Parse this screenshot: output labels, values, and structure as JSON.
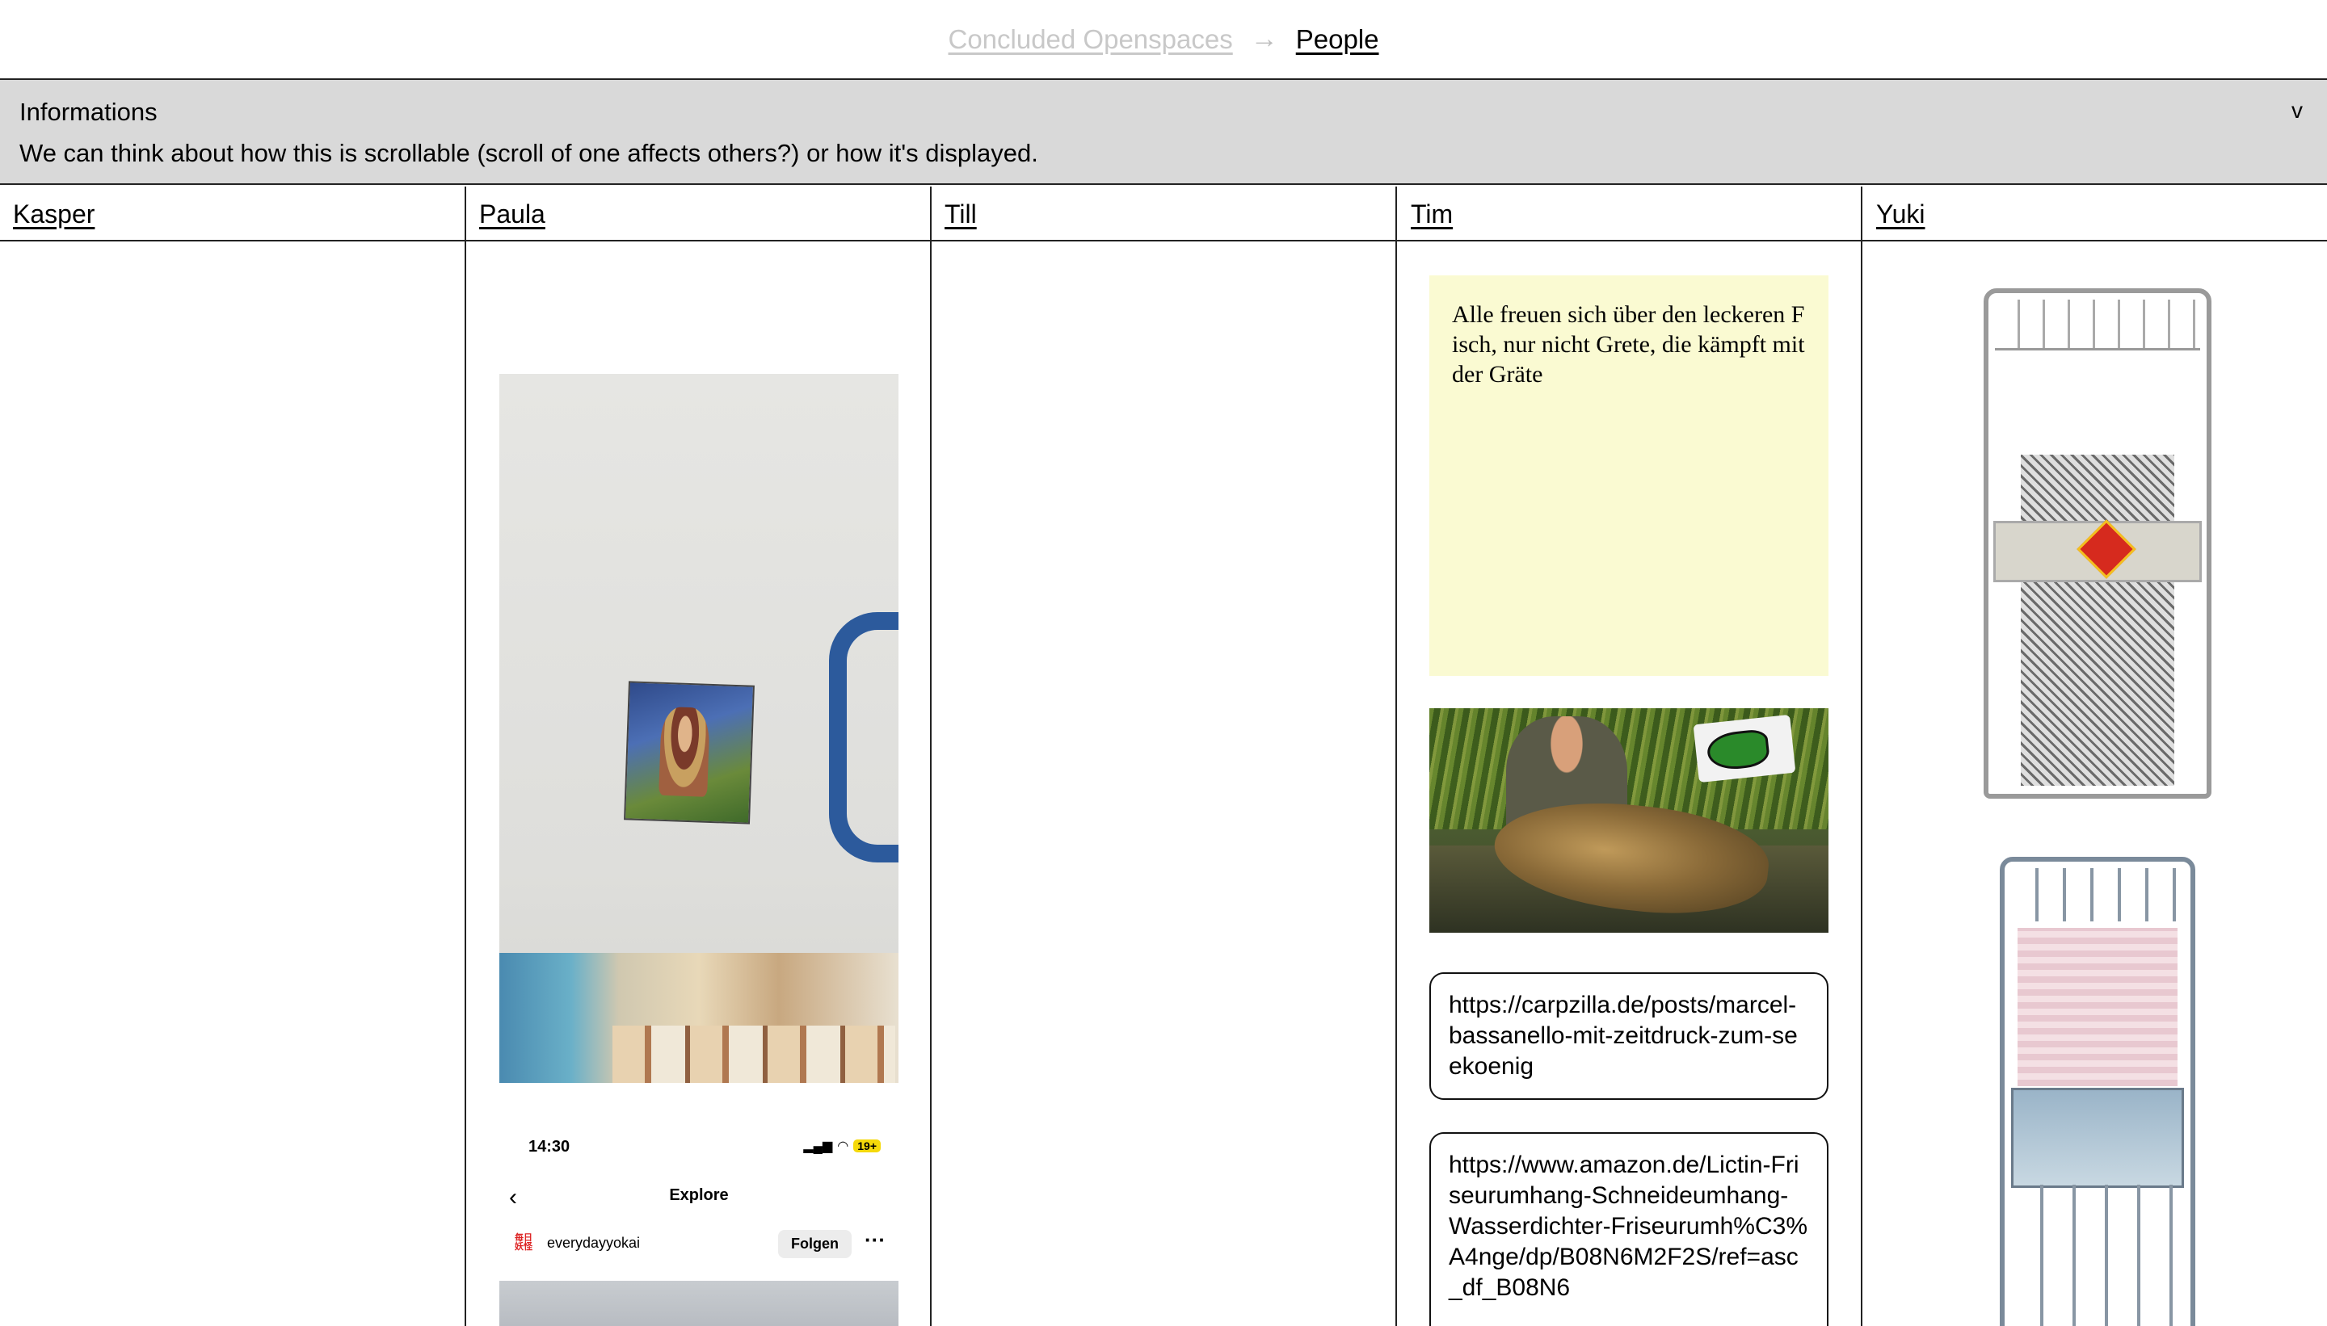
{
  "breadcrumb": {
    "previous": "Concluded Openspaces",
    "separator": "→",
    "current": "People"
  },
  "info": {
    "title": "Informations",
    "text": "We can think about how this is scrollable (scroll of one affects others?) or how it's displayed.",
    "toggle": "v"
  },
  "people": [
    "Kasper",
    "Paula",
    "Till",
    "Tim",
    "Yuki"
  ],
  "paula": {
    "phone": {
      "time": "14:30",
      "battery": "19+",
      "title": "Explore",
      "username": "everydayyokai",
      "avatar_text": "毎日妖怪",
      "follow_label": "Folgen",
      "more": "···"
    }
  },
  "tim": {
    "note": "Alle freuen sich über den leckeren Fisch, nur nicht Grete, die kämpft mit der Gräte",
    "links": [
      "https://carpzilla.de/posts/marcel-bassanello-mit-zeitdruck-zum-seekoenig",
      "https://www.amazon.de/Lictin-Friseurumhang-Schneideumhang-Wasserdichter-Friseurumh%C3%A4nge/dp/B08N6M2F2S/ref=asc_df_B08N6"
    ]
  }
}
